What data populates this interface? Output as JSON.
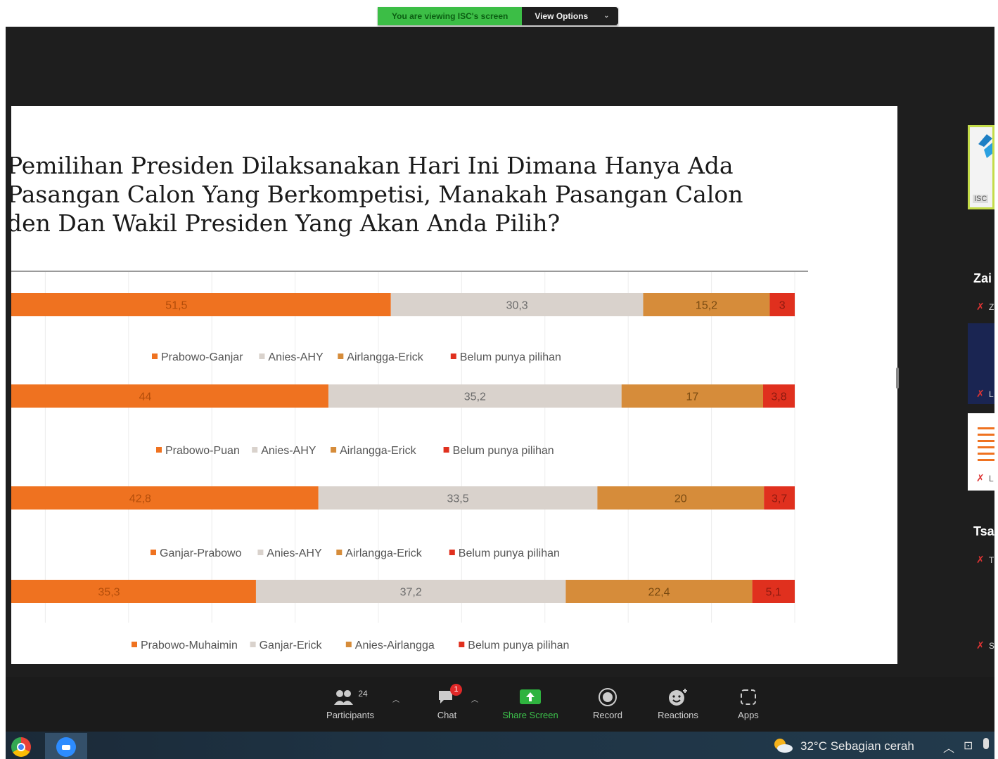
{
  "banner": {
    "status": "You are viewing ISC's screen",
    "view_options": "View Options"
  },
  "slide": {
    "title_lines": [
      "Pemilihan Presiden Dilaksanakan Hari Ini Dimana Hanya Ada",
      "Pasangan Calon Yang Berkompetisi, Manakah Pasangan Calon",
      "den Dan Wakil Presiden Yang Akan Anda Pilih?"
    ]
  },
  "chart_data": {
    "type": "bar",
    "orientation": "horizontal-stacked-100",
    "colors": [
      "#ef7220",
      "#d9d2cc",
      "#d68c3a",
      "#e0301e"
    ],
    "series_groups": [
      {
        "legend": [
          "Prabowo-Ganjar",
          "Anies-AHY",
          "Airlangga-Erick",
          "Belum punya pilihan"
        ],
        "values": [
          51.5,
          30.3,
          15.2,
          3
        ],
        "labels": [
          "51,5",
          "30,3",
          "15,2",
          "3"
        ]
      },
      {
        "legend": [
          "Prabowo-Puan",
          "Anies-AHY",
          "Airlangga-Erick",
          "Belum punya pilihan"
        ],
        "values": [
          44,
          35.2,
          17,
          3.8
        ],
        "labels": [
          "44",
          "35,2",
          "17",
          "3,8"
        ]
      },
      {
        "legend": [
          "Ganjar-Prabowo",
          "Anies-AHY",
          "Airlangga-Erick",
          "Belum punya pilihan"
        ],
        "values": [
          42.8,
          33.5,
          20,
          3.7
        ],
        "labels": [
          "42,8",
          "33,5",
          "20",
          "3,7"
        ]
      },
      {
        "legend": [
          "Prabowo-Muhaimin",
          "Ganjar-Erick",
          "Anies-Airlangga",
          "Belum punya pilihan"
        ],
        "values": [
          35.3,
          37.2,
          22.4,
          5.1
        ],
        "labels": [
          "35,3",
          "37,2",
          "22,4",
          "5,1"
        ]
      }
    ],
    "xlim": [
      0,
      100
    ]
  },
  "participants": [
    {
      "name": "ISC",
      "tile": "ISC"
    },
    {
      "name": "Zai",
      "mic": "Z"
    },
    {
      "mic": "L"
    },
    {
      "mic": "L"
    },
    {
      "name": "Tsa",
      "mic": "T"
    },
    {
      "mic": "S"
    }
  ],
  "toolbar": {
    "participants_label": "Participants",
    "participants_count": "24",
    "chat_label": "Chat",
    "chat_badge": "1",
    "share_label": "Share Screen",
    "record_label": "Record",
    "reactions_label": "Reactions",
    "apps_label": "Apps"
  },
  "taskbar": {
    "weather": "32°C  Sebagian cerah"
  }
}
